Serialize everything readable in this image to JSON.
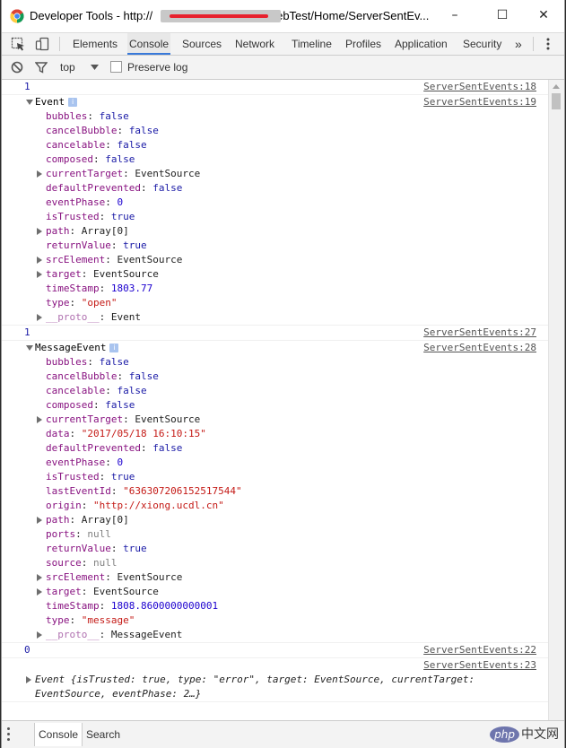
{
  "window": {
    "title_prefix": "Developer Tools - http://",
    "title_suffix": "WebTest/Home/ServerSentEv...",
    "minimize": "–",
    "maximize": "☐",
    "close": "✕"
  },
  "tabs": [
    "Elements",
    "Console",
    "Sources",
    "Network",
    "Timeline",
    "Profiles",
    "Application",
    "Security"
  ],
  "active_tab": "Console",
  "overflow": "»",
  "filter": {
    "context": "top",
    "preserve_log": "Preserve log"
  },
  "console": {
    "msg1": {
      "value": "1",
      "source": "ServerSentEvents:18"
    },
    "event1": {
      "name": "Event",
      "source": "ServerSentEvents:19",
      "props": [
        {
          "key": "bubbles",
          "value": "false",
          "type": "bool",
          "expandable": false
        },
        {
          "key": "cancelBubble",
          "value": "false",
          "type": "bool",
          "expandable": false
        },
        {
          "key": "cancelable",
          "value": "false",
          "type": "bool",
          "expandable": false
        },
        {
          "key": "composed",
          "value": "false",
          "type": "bool",
          "expandable": false
        },
        {
          "key": "currentTarget",
          "value": "EventSource",
          "type": "obj",
          "expandable": true
        },
        {
          "key": "defaultPrevented",
          "value": "false",
          "type": "bool",
          "expandable": false
        },
        {
          "key": "eventPhase",
          "value": "0",
          "type": "num",
          "expandable": false
        },
        {
          "key": "isTrusted",
          "value": "true",
          "type": "bool",
          "expandable": false
        },
        {
          "key": "path",
          "value": "Array[0]",
          "type": "obj",
          "expandable": true
        },
        {
          "key": "returnValue",
          "value": "true",
          "type": "bool",
          "expandable": false
        },
        {
          "key": "srcElement",
          "value": "EventSource",
          "type": "obj",
          "expandable": true
        },
        {
          "key": "target",
          "value": "EventSource",
          "type": "obj",
          "expandable": true
        },
        {
          "key": "timeStamp",
          "value": "1803.77",
          "type": "num",
          "expandable": false
        },
        {
          "key": "type",
          "value": "\"open\"",
          "type": "str",
          "expandable": false
        },
        {
          "key": "__proto__",
          "value": "Event",
          "type": "obj",
          "expandable": true,
          "dim": true
        }
      ]
    },
    "msg2": {
      "value": "1",
      "source": "ServerSentEvents:27"
    },
    "event2": {
      "name": "MessageEvent",
      "source": "ServerSentEvents:28",
      "props": [
        {
          "key": "bubbles",
          "value": "false",
          "type": "bool",
          "expandable": false
        },
        {
          "key": "cancelBubble",
          "value": "false",
          "type": "bool",
          "expandable": false
        },
        {
          "key": "cancelable",
          "value": "false",
          "type": "bool",
          "expandable": false
        },
        {
          "key": "composed",
          "value": "false",
          "type": "bool",
          "expandable": false
        },
        {
          "key": "currentTarget",
          "value": "EventSource",
          "type": "obj",
          "expandable": true
        },
        {
          "key": "data",
          "value": "\"2017/05/18 16:10:15\"",
          "type": "str",
          "expandable": false
        },
        {
          "key": "defaultPrevented",
          "value": "false",
          "type": "bool",
          "expandable": false
        },
        {
          "key": "eventPhase",
          "value": "0",
          "type": "num",
          "expandable": false
        },
        {
          "key": "isTrusted",
          "value": "true",
          "type": "bool",
          "expandable": false
        },
        {
          "key": "lastEventId",
          "value": "\"636307206152517544\"",
          "type": "str",
          "expandable": false
        },
        {
          "key": "origin",
          "value": "\"http://xiong.ucdl.cn\"",
          "type": "str",
          "expandable": false
        },
        {
          "key": "path",
          "value": "Array[0]",
          "type": "obj",
          "expandable": true
        },
        {
          "key": "ports",
          "value": "null",
          "type": "null",
          "expandable": false
        },
        {
          "key": "returnValue",
          "value": "true",
          "type": "bool",
          "expandable": false
        },
        {
          "key": "source",
          "value": "null",
          "type": "null",
          "expandable": false
        },
        {
          "key": "srcElement",
          "value": "EventSource",
          "type": "obj",
          "expandable": true
        },
        {
          "key": "target",
          "value": "EventSource",
          "type": "obj",
          "expandable": true
        },
        {
          "key": "timeStamp",
          "value": "1808.8600000000001",
          "type": "num",
          "expandable": false
        },
        {
          "key": "type",
          "value": "\"message\"",
          "type": "str",
          "expandable": false
        },
        {
          "key": "__proto__",
          "value": "MessageEvent",
          "type": "obj",
          "expandable": true,
          "dim": true
        }
      ]
    },
    "msg3": {
      "value": "0",
      "source": "ServerSentEvents:22"
    },
    "event3": {
      "source": "ServerSentEvents:23",
      "summary_line1": "Event {isTrusted: true, type: \"error\", target: EventSource, currentTarget:",
      "summary_line2": "EventSource, eventPhase: 2…}"
    }
  },
  "drawer": {
    "tabs": [
      "Console",
      "Search"
    ]
  },
  "watermark": {
    "logo": "php",
    "text": "中文网"
  }
}
